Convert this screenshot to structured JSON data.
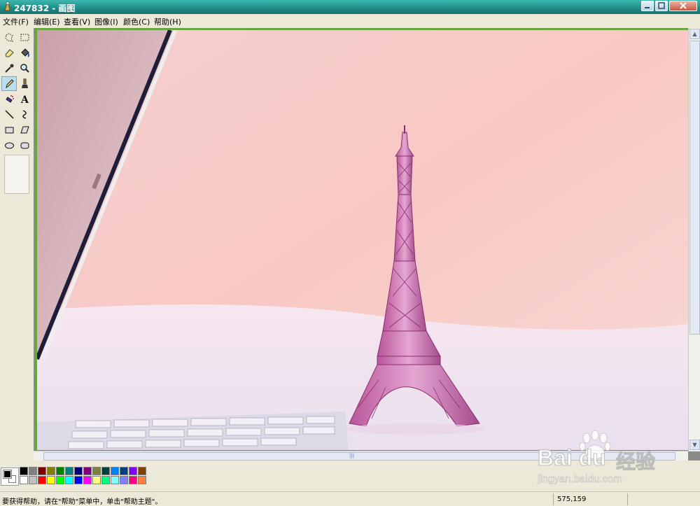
{
  "window": {
    "title": "247832 - 画图"
  },
  "menu": [
    {
      "label": "文件(F)"
    },
    {
      "label": "编辑(E)"
    },
    {
      "label": "查看(V)"
    },
    {
      "label": "图像(I)"
    },
    {
      "label": "颜色(C)"
    },
    {
      "label": "帮助(H)"
    }
  ],
  "tools": [
    {
      "name": "free-form-select-icon"
    },
    {
      "name": "rect-select-icon"
    },
    {
      "name": "eraser-icon"
    },
    {
      "name": "fill-bucket-icon"
    },
    {
      "name": "color-picker-icon"
    },
    {
      "name": "magnifier-icon"
    },
    {
      "name": "pencil-icon",
      "selected": true
    },
    {
      "name": "brush-icon"
    },
    {
      "name": "airbrush-icon"
    },
    {
      "name": "text-icon",
      "glyph": "A"
    },
    {
      "name": "line-icon"
    },
    {
      "name": "curve-icon"
    },
    {
      "name": "rectangle-icon"
    },
    {
      "name": "polygon-icon"
    },
    {
      "name": "ellipse-icon"
    },
    {
      "name": "rounded-rect-icon"
    }
  ],
  "palette": {
    "row1": [
      "#000000",
      "#808080",
      "#800000",
      "#808000",
      "#008000",
      "#008080",
      "#000080",
      "#800080",
      "#808040",
      "#004040",
      "#0080ff",
      "#004080",
      "#8000ff",
      "#804000"
    ],
    "row2": [
      "#ffffff",
      "#c0c0c0",
      "#ff0000",
      "#ffff00",
      "#00ff00",
      "#00ffff",
      "#0000ff",
      "#ff00ff",
      "#ffff80",
      "#00ff80",
      "#80ffff",
      "#8080ff",
      "#ff0080",
      "#ff8040"
    ]
  },
  "status": {
    "help_text": "要获得帮助，请在\"帮助\"菜单中，单击\"帮助主题\"。",
    "coords": "575,159"
  },
  "watermark": {
    "brand_text": "Bai du",
    "brand_cn": "经验",
    "url": "jingyan.baidu.com"
  },
  "colors": {
    "titlebar": "#1f8a86",
    "canvas_border": "#6aa543",
    "background": "#ece9d8"
  }
}
